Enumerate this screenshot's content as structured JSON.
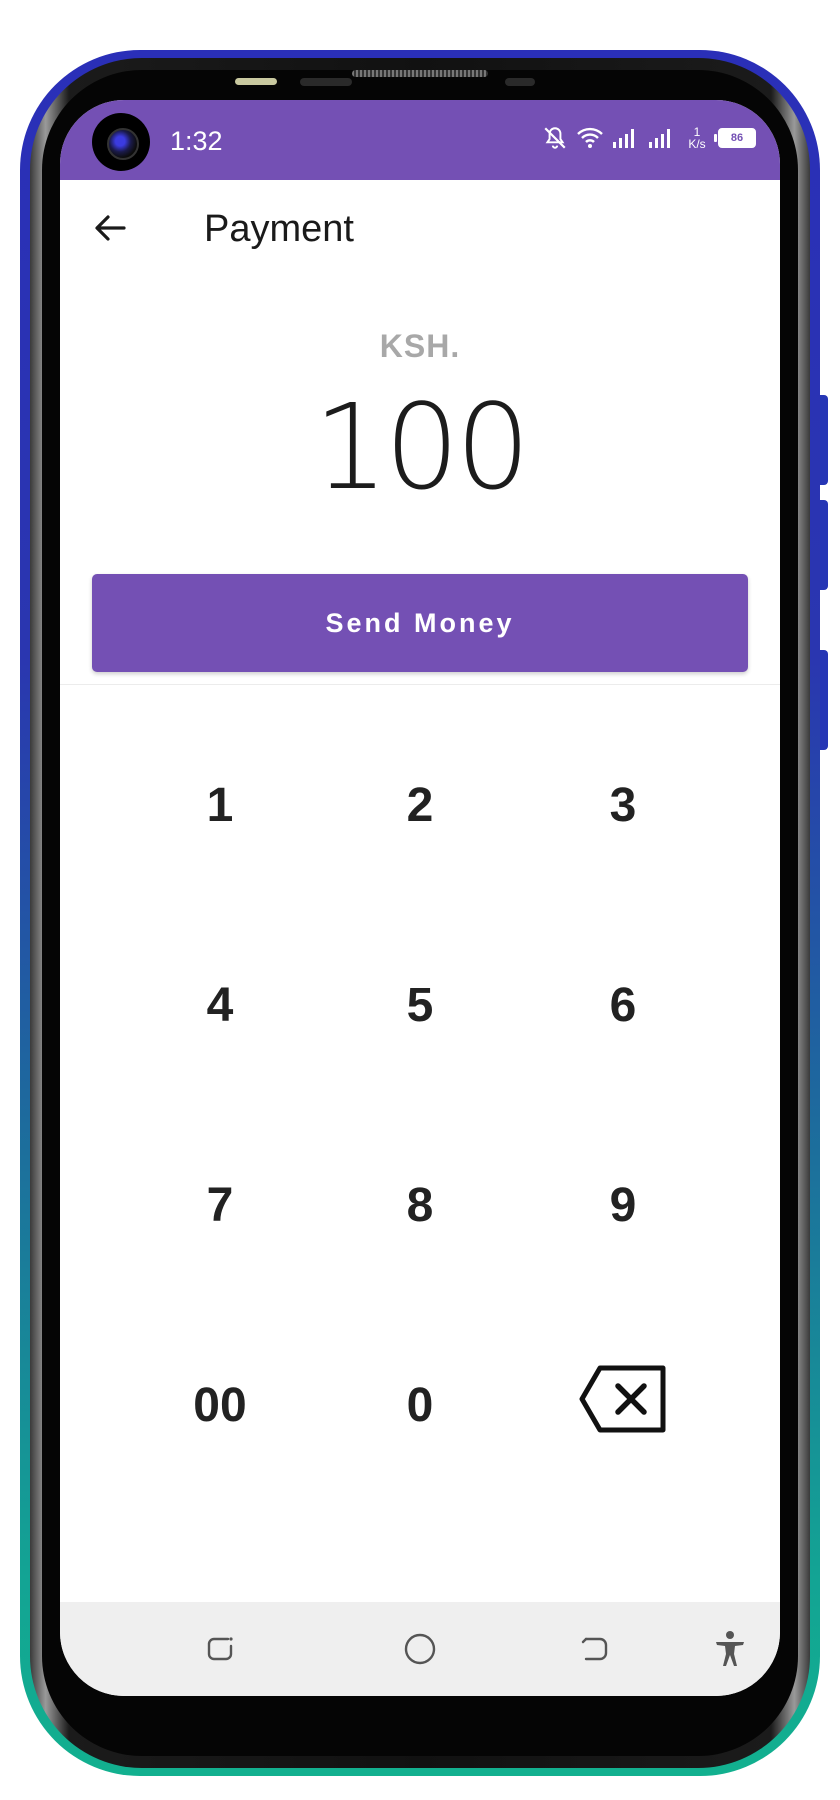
{
  "status_bar": {
    "time": "1:32",
    "network_speed_value": "1",
    "network_speed_unit": "K/s",
    "battery": "86",
    "background_color": "#7450b4",
    "icons": [
      "mute-icon",
      "wifi-icon",
      "signal-icon",
      "signal-icon",
      "battery-icon"
    ]
  },
  "app_bar": {
    "title": "Payment",
    "back_icon": "arrow-left-icon"
  },
  "payment": {
    "currency": "KSH.",
    "amount": "100",
    "send_label": "Send Money",
    "accent_color": "#7450b4"
  },
  "keypad": {
    "keys": [
      "1",
      "2",
      "3",
      "4",
      "5",
      "6",
      "7",
      "8",
      "9",
      "00",
      "0"
    ],
    "backspace_icon": "backspace-icon"
  },
  "nav_bar": {
    "icons": [
      "recent-apps-icon",
      "home-icon",
      "back-icon",
      "accessibility-icon"
    ]
  }
}
